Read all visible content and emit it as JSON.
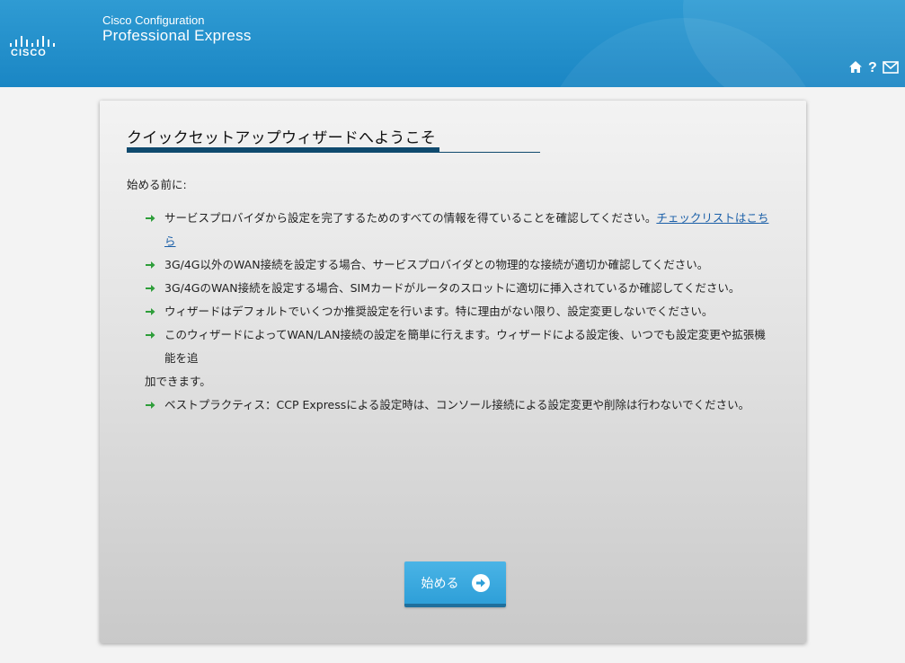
{
  "header": {
    "logo_text": "CISCO",
    "product_line1": "Cisco Configuration",
    "product_line2": "Professional Express",
    "icons": [
      "home-icon",
      "help-icon",
      "mail-icon"
    ],
    "help_glyph": "?"
  },
  "wizard": {
    "title": "クイックセットアップウィザードへようこそ",
    "intro": "始める前に:",
    "items": [
      {
        "text": "サービスプロバイダから設定を完了するためのすべての情報を得ていることを確認してください。",
        "link": "チェックリストはこちら"
      },
      {
        "text": "3G/4G以外のWAN接続を設定する場合、サービスプロバイダとの物理的な接続が適切か確認してください。"
      },
      {
        "text": "3G/4GのWAN接続を設定する場合、SIMカードがルータのスロットに適切に挿入されているか確認してください。"
      },
      {
        "text": "ウィザードはデフォルトでいくつか推奨設定を行います。特に理由がない限り、設定変更しないでください。"
      },
      {
        "text": "このウィザードによってWAN/LAN接続の設定を簡単に行えます。ウィザードによる設定後、いつでも設定変更や拡張機能を追",
        "cont": "加できます。"
      },
      {
        "text": "ベストプラクティス：CCP Expressによる設定時は、コンソール接続による設定変更や削除は行わないでください。"
      }
    ],
    "start_button": "始める"
  },
  "colors": {
    "header_blue": "#1a86c4",
    "accent_dark": "#0f4a6e",
    "arrow_green": "#2e9e3a",
    "button_blue": "#2e9fd8",
    "link": "#1a5fa8"
  }
}
